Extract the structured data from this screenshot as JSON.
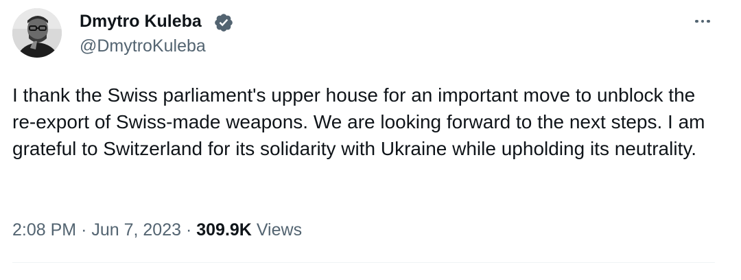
{
  "author": {
    "name": "Dmytro Kuleba",
    "handle": "@DmytroKuleba",
    "verified": true,
    "verified_color": "#536471",
    "avatar_icon": "avatar-photo"
  },
  "tweet": {
    "text": "I thank the Swiss parliament's upper house for an important move to unblock the re-export of Swiss-made weapons. We are looking forward to the next steps. I am grateful to Switzerland for its solidarity with Ukraine while upholding its neutrality.",
    "time": "2:08 PM",
    "separator": "·",
    "date": "Jun 7, 2023",
    "views_count": "309.9K",
    "views_label": "Views"
  },
  "menu": {
    "icon": "more-options-icon"
  },
  "colors": {
    "primary_text": "#0f1419",
    "secondary_text": "#536471",
    "divider": "#eff3f4"
  }
}
